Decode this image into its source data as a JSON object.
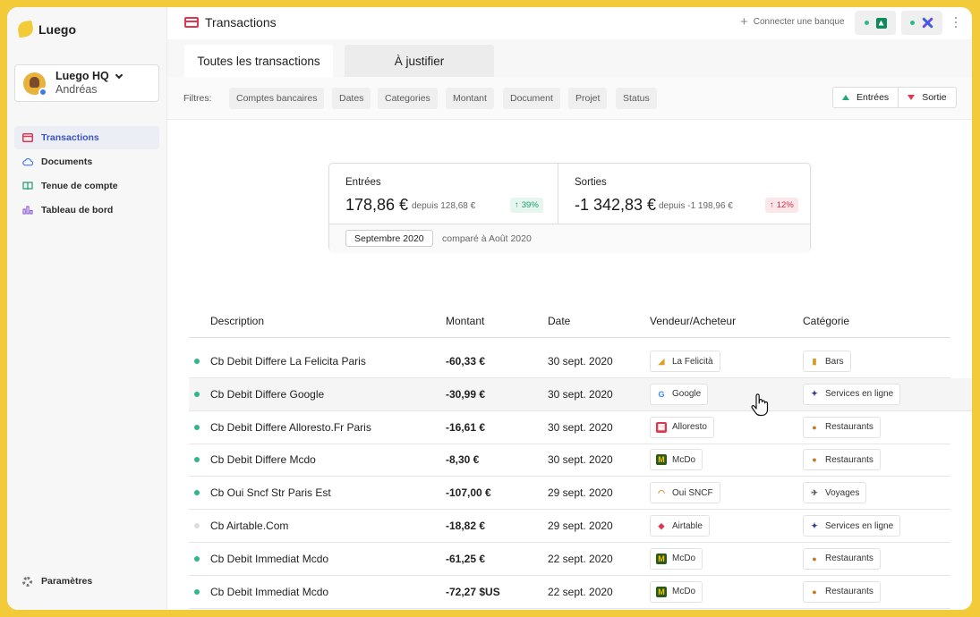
{
  "app": {
    "name": "Luego"
  },
  "org": {
    "name": "Luego HQ",
    "user": "Andréas"
  },
  "nav": [
    {
      "label": "Transactions",
      "icon": "card-icon"
    },
    {
      "label": "Documents",
      "icon": "cloud-icon"
    },
    {
      "label": "Tenue de compte",
      "icon": "book-icon"
    },
    {
      "label": "Tableau de bord",
      "icon": "bar-chart-icon"
    }
  ],
  "settings_label": "Paramètres",
  "header": {
    "title": "Transactions",
    "connect_label": "Connecter une banque"
  },
  "tabs": {
    "all": "Toutes les transactions",
    "justify": "À justifier"
  },
  "filters": {
    "label": "Filtres:",
    "chips": [
      "Comptes bancaires",
      "Dates",
      "Categories",
      "Montant",
      "Document",
      "Projet",
      "Status"
    ],
    "in_label": "Entrées",
    "out_label": "Sortie"
  },
  "summary": {
    "in": {
      "label": "Entrées",
      "amount": "178,86 €",
      "since": "depuis 128,68 €",
      "pct": "39%"
    },
    "out": {
      "label": "Sorties",
      "amount": "-1 342,83 €",
      "since": "depuis -1 198,96 €",
      "pct": "12%"
    },
    "period": "Septembre 2020",
    "compare": "comparé à Août 2020"
  },
  "table": {
    "headers": {
      "description": "Description",
      "amount": "Montant",
      "date": "Date",
      "vendor": "Vendeur/Acheteur",
      "category": "Catégorie"
    },
    "rows": [
      {
        "desc": "Cb Debit Differe La Felicita Paris",
        "amount": "-60,33 €",
        "date": "30 sept. 2020",
        "vendor": "La Felicità",
        "vendor_icon": "felicita-icon",
        "category": "Bars",
        "cat_icon": "beer-icon",
        "status": "done"
      },
      {
        "desc": "Cb Debit Differe Google",
        "amount": "-30,99 €",
        "date": "30 sept. 2020",
        "vendor": "Google",
        "vendor_icon": "google-icon",
        "category": "Services en ligne",
        "cat_icon": "satellite-icon",
        "status": "done"
      },
      {
        "desc": "Cb Debit Differe Alloresto.Fr Paris",
        "amount": "-16,61 €",
        "date": "30 sept. 2020",
        "vendor": "Alloresto",
        "vendor_icon": "alloresto-icon",
        "category": "Restaurants",
        "cat_icon": "burger-icon",
        "status": "done"
      },
      {
        "desc": "Cb Debit Differe Mcdo",
        "amount": "-8,30 €",
        "date": "30 sept. 2020",
        "vendor": "McDo",
        "vendor_icon": "mcdo-icon",
        "category": "Restaurants",
        "cat_icon": "burger-icon",
        "status": "done"
      },
      {
        "desc": "Cb Oui Sncf Str Paris Est",
        "amount": "-107,00 €",
        "date": "29 sept. 2020",
        "vendor": "Oui SNCF",
        "vendor_icon": "sncf-icon",
        "category": "Voyages",
        "cat_icon": "traveler-icon",
        "status": "done"
      },
      {
        "desc": "Cb Airtable.Com",
        "amount": "-18,82 €",
        "date": "29 sept. 2020",
        "vendor": "Airtable",
        "vendor_icon": "airtable-icon",
        "category": "Services en ligne",
        "cat_icon": "satellite-icon",
        "status": "pending"
      },
      {
        "desc": "Cb Debit Immediat Mcdo",
        "amount": "-61,25 €",
        "date": "22 sept. 2020",
        "vendor": "McDo",
        "vendor_icon": "mcdo-icon",
        "category": "Restaurants",
        "cat_icon": "burger-icon",
        "status": "done"
      },
      {
        "desc": "Cb Debit Immediat Mcdo",
        "amount": "-72,27 $US",
        "date": "22 sept. 2020",
        "vendor": "McDo",
        "vendor_icon": "mcdo-icon",
        "category": "Restaurants",
        "cat_icon": "burger-icon",
        "status": "done"
      }
    ]
  },
  "colors": {
    "brand": "#f3cb3a",
    "accent": "#3d53c8",
    "positive": "#1e9c6e",
    "negative": "#d03045"
  }
}
